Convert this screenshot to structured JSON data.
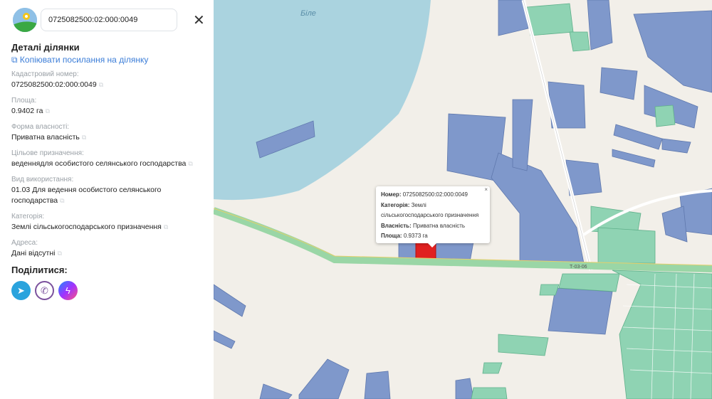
{
  "search": {
    "value": "0725082500:02:000:0049"
  },
  "panel": {
    "title": "Деталі ділянки",
    "copy_link": "Копіювати посилання на ділянку",
    "fields": [
      {
        "label": "Кадастровий номер:",
        "value": "0725082500:02:000:0049"
      },
      {
        "label": "Площа:",
        "value": "0.9402 га"
      },
      {
        "label": "Форма власності:",
        "value": "Приватна власність"
      },
      {
        "label": "Цільове призначення:",
        "value": "веденнядля особистого селянського господарства"
      },
      {
        "label": "Вид використання:",
        "value": "01.03 Для ведення особистого селянського господарства"
      },
      {
        "label": "Категорія:",
        "value": "Землі сільськогосподарського призначення"
      },
      {
        "label": "Адреса:",
        "value": "Дані відсутні"
      }
    ],
    "share_title": "Поділитися:",
    "share": [
      "telegram",
      "viber",
      "messenger"
    ]
  },
  "map": {
    "water_label": "Біле",
    "road_label": "Т-03-06",
    "popup": {
      "number_label": "Номер:",
      "number": "0725082500:02:000:0049",
      "category_label": "Категорія:",
      "category": "Землі сільськогосподарського призначення",
      "ownership_label": "Власність:",
      "ownership": "Приватна власність",
      "area_label": "Площа:",
      "area": "0.9373 га",
      "close": "×"
    },
    "colors": {
      "water": "#aad3df",
      "parcel": "#7f98cb",
      "parcel_green": "#8fd3b3",
      "selected": "#e02020",
      "bg": "#f2efe9"
    }
  }
}
